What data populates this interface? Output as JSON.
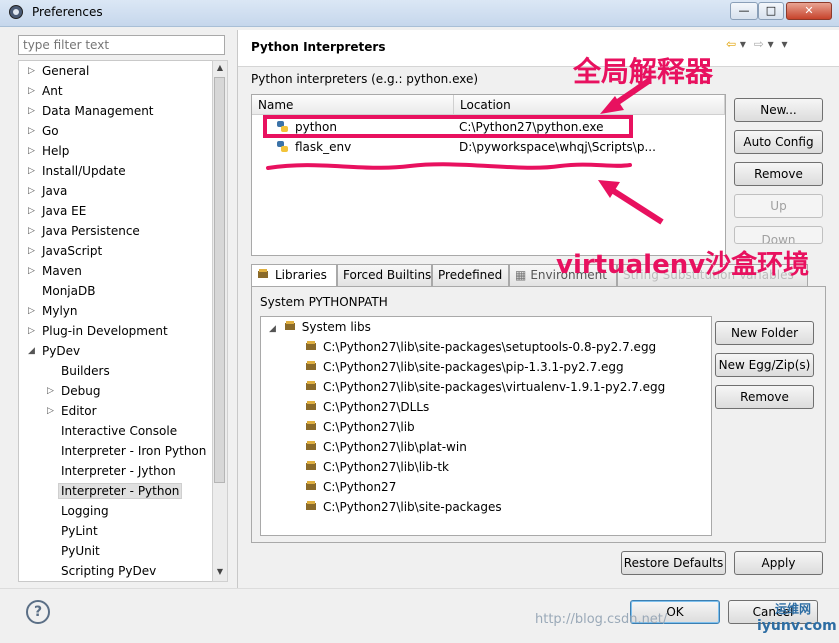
{
  "window": {
    "title": "Preferences",
    "controls": [
      "—",
      "□",
      "✕"
    ]
  },
  "filter": {
    "placeholder": "type filter text"
  },
  "tree": [
    {
      "label": "General",
      "arrow": "▷",
      "indent": 0
    },
    {
      "label": "Ant",
      "arrow": "▷",
      "indent": 0
    },
    {
      "label": "Data Management",
      "arrow": "▷",
      "indent": 0
    },
    {
      "label": "Go",
      "arrow": "▷",
      "indent": 0
    },
    {
      "label": "Help",
      "arrow": "▷",
      "indent": 0
    },
    {
      "label": "Install/Update",
      "arrow": "▷",
      "indent": 0
    },
    {
      "label": "Java",
      "arrow": "▷",
      "indent": 0
    },
    {
      "label": "Java EE",
      "arrow": "▷",
      "indent": 0
    },
    {
      "label": "Java Persistence",
      "arrow": "▷",
      "indent": 0
    },
    {
      "label": "JavaScript",
      "arrow": "▷",
      "indent": 0
    },
    {
      "label": "Maven",
      "arrow": "▷",
      "indent": 0
    },
    {
      "label": "MonjaDB",
      "arrow": "",
      "indent": 0
    },
    {
      "label": "Mylyn",
      "arrow": "▷",
      "indent": 0
    },
    {
      "label": "Plug-in Development",
      "arrow": "▷",
      "indent": 0
    },
    {
      "label": "PyDev",
      "arrow": "◢",
      "indent": 0
    },
    {
      "label": "Builders",
      "arrow": "",
      "indent": 1
    },
    {
      "label": "Debug",
      "arrow": "▷",
      "indent": 1
    },
    {
      "label": "Editor",
      "arrow": "▷",
      "indent": 1
    },
    {
      "label": "Interactive Console",
      "arrow": "",
      "indent": 1
    },
    {
      "label": "Interpreter - Iron Python",
      "arrow": "",
      "indent": 1
    },
    {
      "label": "Interpreter - Jython",
      "arrow": "",
      "indent": 1
    },
    {
      "label": "Interpreter - Python",
      "arrow": "",
      "indent": 1,
      "selected": true
    },
    {
      "label": "Logging",
      "arrow": "",
      "indent": 1
    },
    {
      "label": "PyLint",
      "arrow": "",
      "indent": 1
    },
    {
      "label": "PyUnit",
      "arrow": "",
      "indent": 1
    },
    {
      "label": "Scripting PyDev",
      "arrow": "",
      "indent": 1
    }
  ],
  "page": {
    "title": "Python Interpreters",
    "description": "Python interpreters (e.g.: python.exe)",
    "nav": [
      "⇦",
      "▾",
      "⇨",
      "▾",
      "▾"
    ]
  },
  "interpreters": {
    "columns": [
      "Name",
      "Location"
    ],
    "rows": [
      {
        "name": "python",
        "location": "C:\\Python27\\python.exe"
      },
      {
        "name": "flask_env",
        "location": "D:\\pyworkspace\\whqj\\Scripts\\p..."
      }
    ]
  },
  "interp_buttons": [
    {
      "label": "New...",
      "enabled": true
    },
    {
      "label": "Auto Config",
      "enabled": true
    },
    {
      "label": "Remove",
      "enabled": true
    },
    {
      "label": "Up",
      "enabled": false
    },
    {
      "label": "Down",
      "enabled": false
    }
  ],
  "tabs": [
    "Libraries",
    "Forced Builtins",
    "Predefined",
    "Environment",
    "String Substitution Variables"
  ],
  "libraries": {
    "label": "System PYTHONPATH",
    "root": "System libs",
    "paths": [
      "C:\\Python27\\lib\\site-packages\\setuptools-0.8-py2.7.egg",
      "C:\\Python27\\lib\\site-packages\\pip-1.3.1-py2.7.egg",
      "C:\\Python27\\lib\\site-packages\\virtualenv-1.9.1-py2.7.egg",
      "C:\\Python27\\DLLs",
      "C:\\Python27\\lib",
      "C:\\Python27\\lib\\plat-win",
      "C:\\Python27\\lib\\lib-tk",
      "C:\\Python27",
      "C:\\Python27\\lib\\site-packages"
    ]
  },
  "lib_buttons": [
    "New Folder",
    "New Egg/Zip(s)",
    "Remove"
  ],
  "footer_buttons": {
    "restore": "Restore Defaults",
    "apply": "Apply",
    "ok": "OK",
    "cancel": "Cancel"
  },
  "annotations": {
    "global": "全局解释器",
    "virtualenv": "virtualenv沙盒环境",
    "color": "#e8115f"
  },
  "watermark": {
    "url": "http://blog.csdn.net/",
    "brand": "运维网",
    "domain": "iyunv.com"
  }
}
